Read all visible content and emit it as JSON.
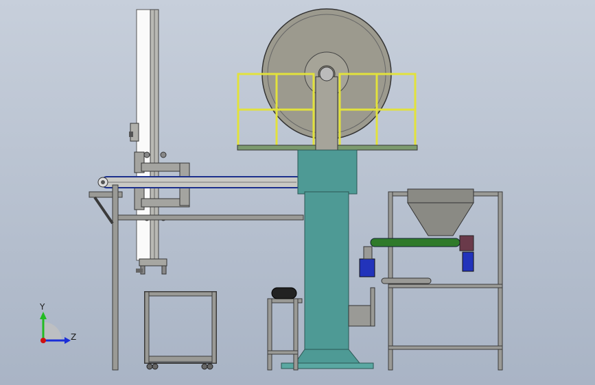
{
  "axis_triad": {
    "y_label": "Y",
    "z_label": "Z",
    "y_color": "#22bb22",
    "z_color": "#1a2ed8",
    "origin_color": "#d01010"
  },
  "colors": {
    "frame_steel": "#9a9a96",
    "frame_edge": "#3a3a3a",
    "column_teal": "#4e9a95",
    "wheel_gray": "#9c9a8e",
    "railing_yellow": "#e2e23c",
    "platform_green": "#7c9a6e",
    "conveyor_blue": "#1b2f8c",
    "screw_green": "#2f7a2a",
    "motor_blue": "#2233bb",
    "hopper_gray": "#8a8a84",
    "mast_white": "#fafafa"
  }
}
